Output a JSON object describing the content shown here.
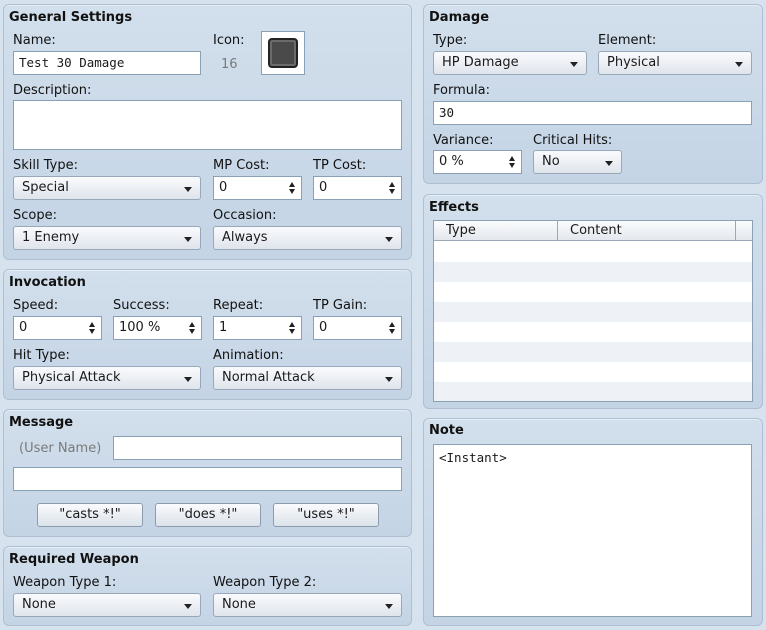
{
  "general": {
    "title": "General Settings",
    "name_label": "Name:",
    "name_value": "Test 30 Damage",
    "icon_label": "Icon:",
    "icon_index": "16",
    "description_label": "Description:",
    "description_value": "",
    "skill_type_label": "Skill Type:",
    "skill_type_value": "Special",
    "mp_cost_label": "MP Cost:",
    "mp_cost_value": "0",
    "tp_cost_label": "TP Cost:",
    "tp_cost_value": "0",
    "scope_label": "Scope:",
    "scope_value": "1 Enemy",
    "occasion_label": "Occasion:",
    "occasion_value": "Always"
  },
  "invocation": {
    "title": "Invocation",
    "speed_label": "Speed:",
    "speed_value": "0",
    "success_label": "Success:",
    "success_value": "100 %",
    "repeat_label": "Repeat:",
    "repeat_value": "1",
    "tp_gain_label": "TP Gain:",
    "tp_gain_value": "0",
    "hit_type_label": "Hit Type:",
    "hit_type_value": "Physical Attack",
    "animation_label": "Animation:",
    "animation_value": "Normal Attack"
  },
  "message": {
    "title": "Message",
    "user_name_label": "(User Name)",
    "line1_value": "",
    "line2_value": "",
    "buttons": [
      "\"casts *!\"",
      "\"does *!\"",
      "\"uses *!\""
    ]
  },
  "required_weapon": {
    "title": "Required Weapon",
    "type1_label": "Weapon Type 1:",
    "type1_value": "None",
    "type2_label": "Weapon Type 2:",
    "type2_value": "None"
  },
  "damage": {
    "title": "Damage",
    "type_label": "Type:",
    "type_value": "HP Damage",
    "element_label": "Element:",
    "element_value": "Physical",
    "formula_label": "Formula:",
    "formula_value": "30",
    "variance_label": "Variance:",
    "variance_value": "0 %",
    "critical_label": "Critical Hits:",
    "critical_value": "No"
  },
  "effects": {
    "title": "Effects",
    "columns": [
      "Type",
      "Content"
    ],
    "rows": []
  },
  "note": {
    "title": "Note",
    "value": "<Instant>"
  }
}
